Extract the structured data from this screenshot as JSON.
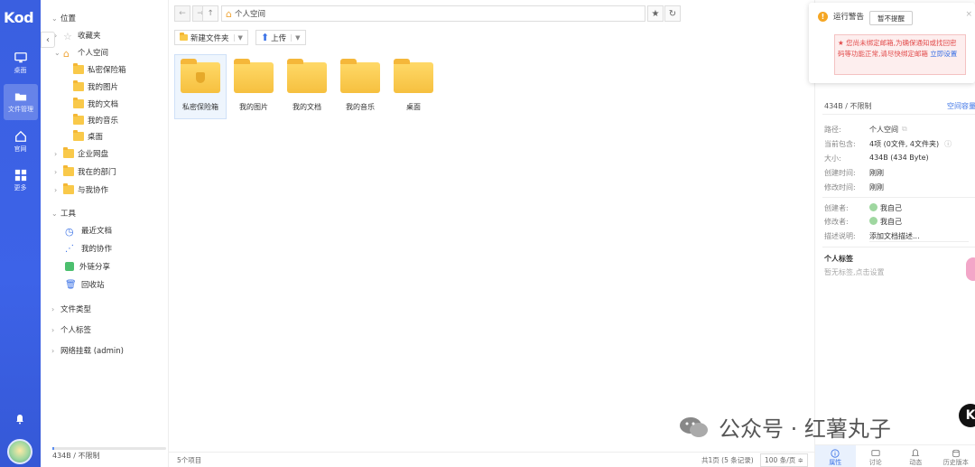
{
  "app": {
    "logo": "Kod"
  },
  "rail": {
    "items": [
      {
        "label": "桌面",
        "icon": "monitor-icon"
      },
      {
        "label": "文件管理",
        "icon": "folder-icon"
      },
      {
        "label": "官网",
        "icon": "home-icon"
      },
      {
        "label": "更多",
        "icon": "grid-icon"
      }
    ]
  },
  "tree": {
    "location": "位置",
    "favorites": "收藏夹",
    "personal": "个人空间",
    "personal_children": [
      "私密保险箱",
      "我的图片",
      "我的文档",
      "我的音乐",
      "桌面"
    ],
    "enterprise": "企业网盘",
    "dept": "我在的部门",
    "collab": "与我协作",
    "tools": "工具",
    "tool_items": [
      "最近文档",
      "我的协作",
      "外链分享",
      "回收站"
    ],
    "filetype": "文件类型",
    "tags": "个人标签",
    "netmount": "网络挂载 (admin)",
    "quota": "434B / 不限制"
  },
  "pathbar": {
    "crumb": "个人空间"
  },
  "toolbar": {
    "new_folder": "新建文件夹",
    "upload": "上传"
  },
  "files": [
    "私密保险箱",
    "我的图片",
    "我的文档",
    "我的音乐",
    "桌面"
  ],
  "footer": {
    "count": "5个项目",
    "pages": "共1页 (5 条记录)",
    "per_page": "100 条/页 ≑"
  },
  "warning": {
    "title": "运行警告",
    "snooze": "暂不提醒",
    "close": "×",
    "message": "您尚未绑定邮箱,为确保通知或找回密码等功能正常,请尽快绑定邮箱",
    "link": "立即设置",
    "star": "★"
  },
  "info": {
    "quota": "434B / 不限制",
    "quota_link": "空间容量",
    "path_k": "路径:",
    "path_v": "个人空间",
    "contains_k": "当前包含:",
    "contains_v": "4项 (0文件, 4文件夹)",
    "size_k": "大小:",
    "size_v": "434B (434 Byte)",
    "created_k": "创建时间:",
    "created_v": "刚刚",
    "modified_k": "修改时间:",
    "modified_v": "刚刚",
    "creator_k": "创建者:",
    "creator_v": "我自己",
    "modifier_k": "修改者:",
    "modifier_v": "我自己",
    "desc_k": "描述说明:",
    "desc_placeholder": "添加文档描述...",
    "tags_title": "个人标签",
    "tags_hint": "暂无标签,点击设置",
    "tabs": [
      "属性",
      "讨论",
      "动态",
      "历史版本"
    ]
  },
  "watermark": {
    "text": "公众号 · 红薯丸子",
    "badge": "K"
  },
  "colors": {
    "accent": "#3d63e8",
    "folder": "#f9c94a",
    "warn": "#f5a623",
    "error": "#e24c4c",
    "link": "#3b72e6"
  }
}
